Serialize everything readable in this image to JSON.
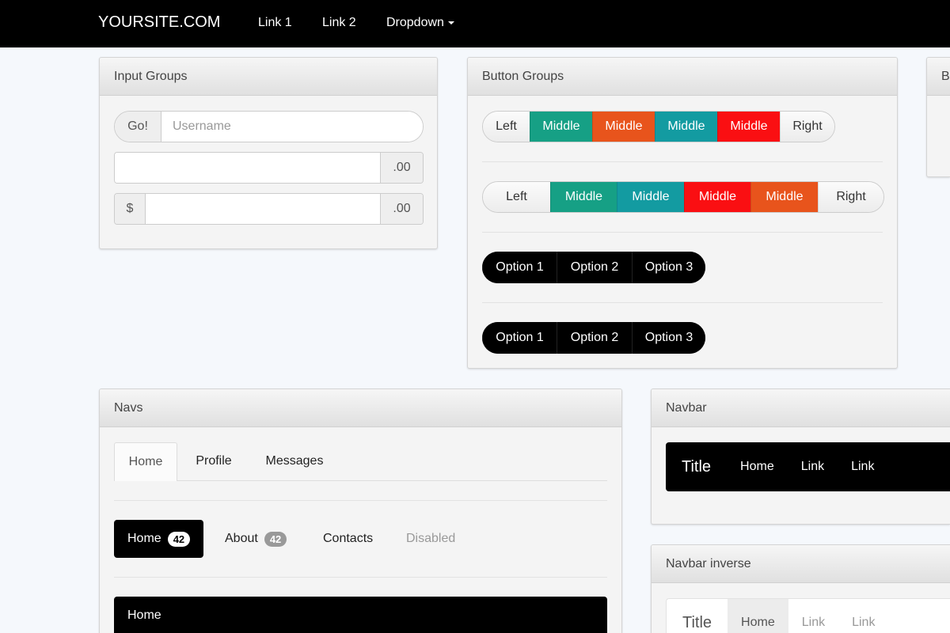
{
  "topnav": {
    "brand": "YOURSITE.COM",
    "links": [
      "Link 1",
      "Link 2"
    ],
    "dropdown": "Dropdown"
  },
  "input_groups": {
    "title": "Input Groups",
    "go_label": "Go!",
    "username_placeholder": "Username",
    "cents_label": ".00",
    "dollar_label": "$"
  },
  "button_groups": {
    "title": "Button Groups",
    "group1": [
      "Left",
      "Middle",
      "Middle",
      "Middle",
      "Middle",
      "Right"
    ],
    "group2": [
      "Left",
      "Middle",
      "Middle",
      "Middle",
      "Middle",
      "Right"
    ],
    "group3": [
      "Option 1",
      "Option 2",
      "Option 3"
    ],
    "group4": [
      "Option 1",
      "Option 2",
      "Option 3"
    ],
    "colors": {
      "green": "#16a085",
      "orange": "#e8541c",
      "teal": "#139ba1",
      "red": "#fa0f12"
    }
  },
  "partial_panel": {
    "title": "B"
  },
  "navs": {
    "title": "Navs",
    "tabs": [
      "Home",
      "Profile",
      "Messages"
    ],
    "pills": {
      "home": "Home",
      "home_badge": "42",
      "about": "About",
      "about_badge": "42",
      "contacts": "Contacts",
      "disabled": "Disabled"
    },
    "stacked_home": "Home"
  },
  "navbar": {
    "title": "Navbar",
    "brand": "Title",
    "links": [
      "Home",
      "Link",
      "Link"
    ]
  },
  "navbar_inverse": {
    "title": "Navbar inverse",
    "brand": "Title",
    "links": [
      "Home",
      "Link",
      "Link"
    ]
  }
}
